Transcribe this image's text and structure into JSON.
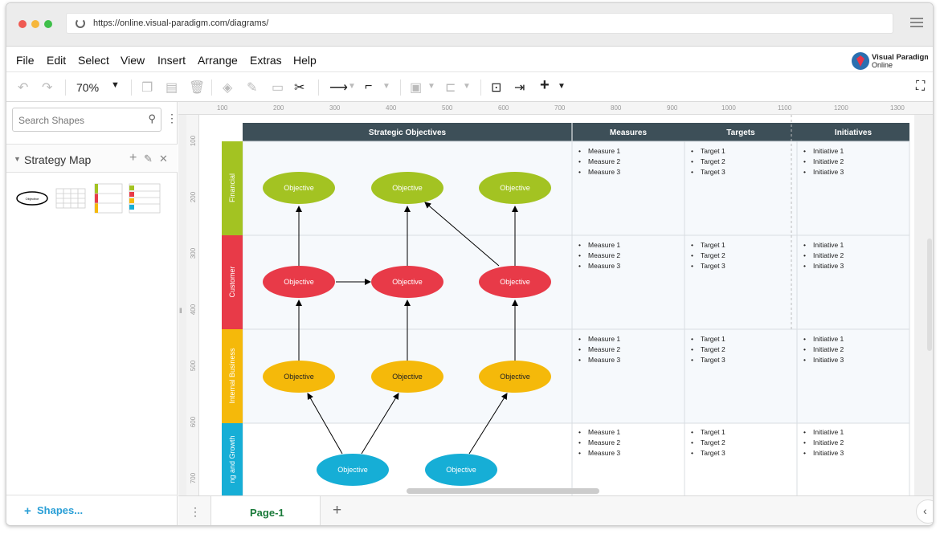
{
  "browser": {
    "url": "https://online.visual-paradigm.com/diagrams/",
    "dot_colors": [
      "#ef5a52",
      "#f6b73c",
      "#3fbf4a"
    ]
  },
  "menu": {
    "items": [
      "File",
      "Edit",
      "Select",
      "View",
      "Insert",
      "Arrange",
      "Extras",
      "Help"
    ],
    "brand_line1": "Visual Paradigm",
    "brand_line2": "Online"
  },
  "toolbar": {
    "zoom": "70%"
  },
  "sidebar": {
    "search_placeholder": "Search Shapes",
    "section_title": "Strategy Map",
    "shapes_link": "Shapes...",
    "thumb_oval_label": "Objective"
  },
  "ruler": {
    "top": [
      "100",
      "200",
      "300",
      "400",
      "500",
      "600",
      "700",
      "800",
      "900",
      "1000",
      "1100",
      "1200",
      "1300"
    ],
    "left": [
      "100",
      "200",
      "300",
      "400",
      "500",
      "600",
      "700"
    ]
  },
  "diagram": {
    "headers": [
      "Strategic Objectives",
      "Measures",
      "Targets",
      "Initiatives"
    ],
    "perspectives": [
      {
        "label": "Financial",
        "color": "#a3c322"
      },
      {
        "label": "Customer",
        "color": "#e83a48"
      },
      {
        "label": "Internal Business",
        "color": "#f5b90a"
      },
      {
        "label": "ng and Growth",
        "color": "#16aed6"
      }
    ],
    "objective_label": "Objective",
    "measures": [
      "Measure 1",
      "Measure 2",
      "Measure 3"
    ],
    "targets": [
      "Target 1",
      "Target 2",
      "Target 3"
    ],
    "initiatives": [
      "Initiative 1",
      "Initiative 2",
      "Initiative 3"
    ]
  },
  "bottom": {
    "page_tab": "Page-1"
  }
}
